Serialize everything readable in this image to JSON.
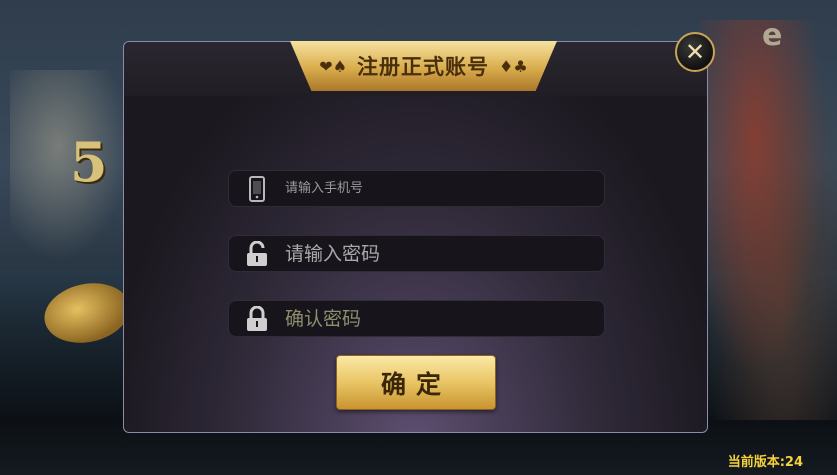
{
  "dialog": {
    "title": "注册正式账号",
    "left_suits": "❤♠",
    "right_suits": "♦♣",
    "close_label": "✕"
  },
  "form": {
    "phone_placeholder": "请输入手机号",
    "password_placeholder": "请输入密码",
    "confirm_password_placeholder": "确认密码",
    "submit_label": "确定"
  },
  "background": {
    "badge_number": "5",
    "corner_letter": "e"
  },
  "footer": {
    "version_text": "当前版本:24"
  },
  "colors": {
    "gold": "#e9c565",
    "version": "#f5d23a",
    "dialog_border": "#8a8da3"
  }
}
